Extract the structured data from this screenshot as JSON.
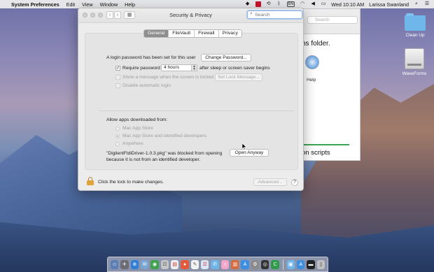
{
  "menubar": {
    "app_name": "System Preferences",
    "items": [
      "Edit",
      "View",
      "Window",
      "Help"
    ],
    "clock": "Wed 10:10 AM",
    "user": "Larissa Swanland",
    "input_badge": "EN"
  },
  "background_window": {
    "search_placeholder": "Search",
    "text_top": "ns folder.",
    "help_label": "Help",
    "text_bottom": "on scripts"
  },
  "window": {
    "title": "Security & Privacy",
    "search_placeholder": "Search",
    "tabs": [
      {
        "label": "General",
        "active": true
      },
      {
        "label": "FileVault",
        "active": false
      },
      {
        "label": "Firewall",
        "active": false
      },
      {
        "label": "Privacy",
        "active": false
      }
    ]
  },
  "general": {
    "login_password_text": "A login password has been set for this user",
    "change_password_label": "Change Password...",
    "require_password_label": "Require password",
    "require_password_checked": true,
    "require_password_value": "4 hours",
    "after_sleep_text": "after sleep or screen saver begins",
    "show_message_label": "Show a message when the screen is locked",
    "set_lock_message_label": "Set Lock Message...",
    "disable_auto_login_label": "Disable automatic login",
    "allow_apps_label": "Allow apps downloaded from:",
    "radio_options": [
      "Mac App Store",
      "Mac App Store and identified developers",
      "Anywhere"
    ],
    "radio_selected": "Mac App Store and identified developers",
    "blocked_line1": "\"DigilentFtdiDriver-1.0.3.pkg\" was blocked from opening",
    "blocked_line2": "because it is not from an identified developer.",
    "open_anyway_label": "Open Anyway"
  },
  "footer": {
    "lock_text": "Click the lock to make changes.",
    "advanced_label": "Advanced...",
    "help_label": "?"
  },
  "desktop": {
    "icons": [
      {
        "label": "Clean Up",
        "icon": "folder-icon"
      },
      {
        "label": "WaveForms",
        "icon": "drive-icon"
      }
    ]
  },
  "colors": {
    "accent_blue": "#a8c6ee",
    "lock_gold": "#e0a53a",
    "tab_active": "#8e8e8e"
  }
}
